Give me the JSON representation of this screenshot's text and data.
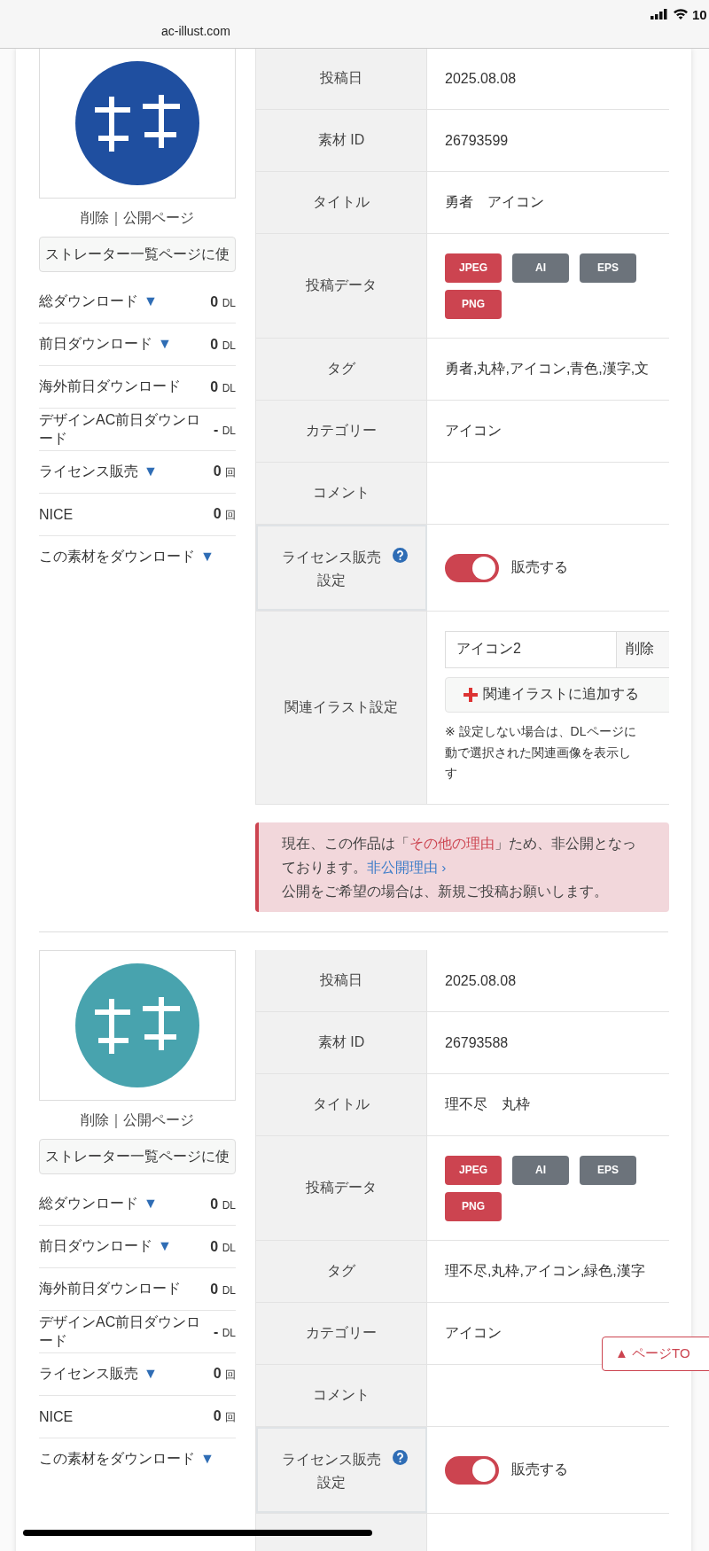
{
  "status_bar": {
    "url": "ac-illust.com",
    "time": "10"
  },
  "items": [
    {
      "actions": {
        "delete": "削除",
        "separator": "｜",
        "public": "公開ページ"
      },
      "list_button": "ストレーター一覧ページに使",
      "stats": [
        {
          "label": "総ダウンロード",
          "marker": "▼",
          "value": "0",
          "unit": "DL"
        },
        {
          "label": "前日ダウンロード",
          "marker": "▼",
          "value": "0",
          "unit": "DL"
        },
        {
          "label": "海外前日ダウンロード",
          "value": "0",
          "unit": "DL"
        },
        {
          "label": "デザインAC前日ダウンロード",
          "value": "-",
          "unit": "DL"
        },
        {
          "label": "ライセンス販売",
          "marker": "▼",
          "value": "0",
          "unit": "回"
        },
        {
          "label": "NICE",
          "value": "0",
          "unit": "回"
        },
        {
          "label": "この素材をダウンロード",
          "marker": "▼"
        }
      ],
      "rows": [
        {
          "kind": "text",
          "label": "投稿日",
          "value": "2025.08.08"
        },
        {
          "kind": "text",
          "label": "素材 ID",
          "value": "26793599"
        },
        {
          "kind": "text",
          "label": "タイトル",
          "value": "勇者　アイコン"
        },
        {
          "kind": "badges",
          "label": "投稿データ",
          "badges": [
            {
              "label": "JPEG",
              "color": "#cc4450"
            },
            {
              "label": "AI",
              "color": "#6c737b"
            },
            {
              "label": "EPS",
              "color": "#6c737b"
            },
            {
              "label": "PNG",
              "color": "#cc4450"
            }
          ]
        },
        {
          "kind": "text",
          "label": "タグ",
          "value": "勇者,丸枠,アイコン,青色,漢字,文"
        },
        {
          "kind": "text",
          "label": "カテゴリー",
          "value": "アイコン"
        },
        {
          "kind": "text",
          "label": "コメント"
        },
        {
          "kind": "toggle",
          "label": "ライセンス販売設定",
          "on": true,
          "toggle_label": "販売する"
        },
        {
          "kind": "related",
          "label": "関連イラスト設定",
          "input_value": "アイコン2",
          "delete_button": "削除",
          "add_button": "関連イラストに追加する",
          "note_lines": [
            "※ 設定しない場合は、DLページに",
            "動で選択された関連画像を表示し",
            "す"
          ]
        }
      ],
      "alert": {
        "before": "現在、この作品は「",
        "reason": "その他の理由",
        "after": "」ため、非公開となっております。",
        "link": "非公開理由 ›",
        "line2": "公開をご希望の場合は、新規ご投稿お願いします。"
      }
    },
    {
      "actions": {
        "delete": "削除",
        "separator": "｜",
        "public": "公開ページ"
      },
      "list_button": "ストレーター一覧ページに使",
      "stats": [
        {
          "label": "総ダウンロード",
          "marker": "▼",
          "value": "0",
          "unit": "DL"
        },
        {
          "label": "前日ダウンロード",
          "marker": "▼",
          "value": "0",
          "unit": "DL"
        },
        {
          "label": "海外前日ダウンロード",
          "value": "0",
          "unit": "DL"
        },
        {
          "label": "デザインAC前日ダウンロード",
          "value": "-",
          "unit": "DL"
        },
        {
          "label": "ライセンス販売",
          "marker": "▼",
          "value": "0",
          "unit": "回"
        },
        {
          "label": "NICE",
          "value": "0",
          "unit": "回"
        },
        {
          "label": "この素材をダウンロード",
          "marker": "▼"
        }
      ],
      "rows": [
        {
          "kind": "text",
          "label": "投稿日",
          "value": "2025.08.08"
        },
        {
          "kind": "text",
          "label": "素材 ID",
          "value": "26793588"
        },
        {
          "kind": "text",
          "label": "タイトル",
          "value": "理不尽　丸枠"
        },
        {
          "kind": "badges",
          "label": "投稿データ",
          "badges": [
            {
              "label": "JPEG",
              "color": "#cc4450"
            },
            {
              "label": "AI",
              "color": "#6c737b"
            },
            {
              "label": "EPS",
              "color": "#6c737b"
            },
            {
              "label": "PNG",
              "color": "#cc4450"
            }
          ]
        },
        {
          "kind": "text",
          "label": "タグ",
          "value": "理不尽,丸枠,アイコン,緑色,漢字"
        },
        {
          "kind": "text",
          "label": "カテゴリー",
          "value": "アイコン"
        },
        {
          "kind": "text",
          "label": "コメント"
        },
        {
          "kind": "toggle",
          "label": "ライセンス販売設定",
          "on": true,
          "toggle_label": "販売する"
        },
        {
          "kind": "empty"
        }
      ]
    }
  ],
  "page_top_button": "▲ ページTO"
}
